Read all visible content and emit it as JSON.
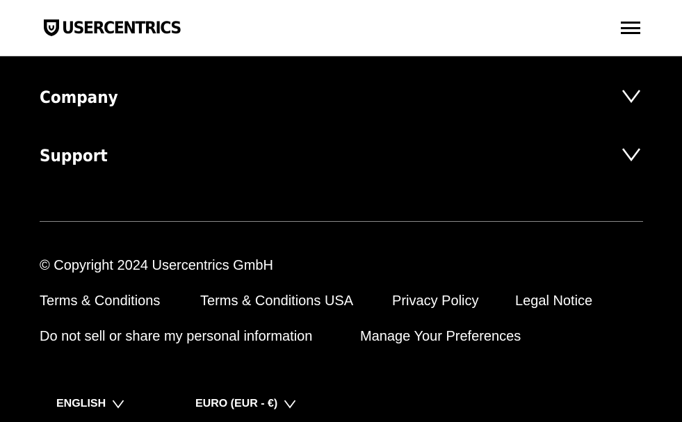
{
  "header": {
    "logo_text": "USERCENTRICS",
    "menu_icon": "hamburger-menu-icon"
  },
  "accordion": [
    {
      "label": "Company",
      "icon": "chevron-down-icon"
    },
    {
      "label": "Support",
      "icon": "chevron-down-icon"
    }
  ],
  "footer": {
    "copyright": "© Copyright 2024 Usercentrics GmbH",
    "links_row1": [
      "Terms & Conditions",
      "Terms & Conditions USA",
      "Privacy Policy",
      "Legal Notice"
    ],
    "links_row2": [
      "Do not sell or share my personal information",
      "Manage Your Preferences"
    ],
    "language": "ENGLISH",
    "currency": "EURO (EUR - €)"
  },
  "colors": {
    "background": "#000000",
    "header_background": "#ffffff",
    "text": "#ffffff",
    "divider": "#8a8a8a"
  }
}
